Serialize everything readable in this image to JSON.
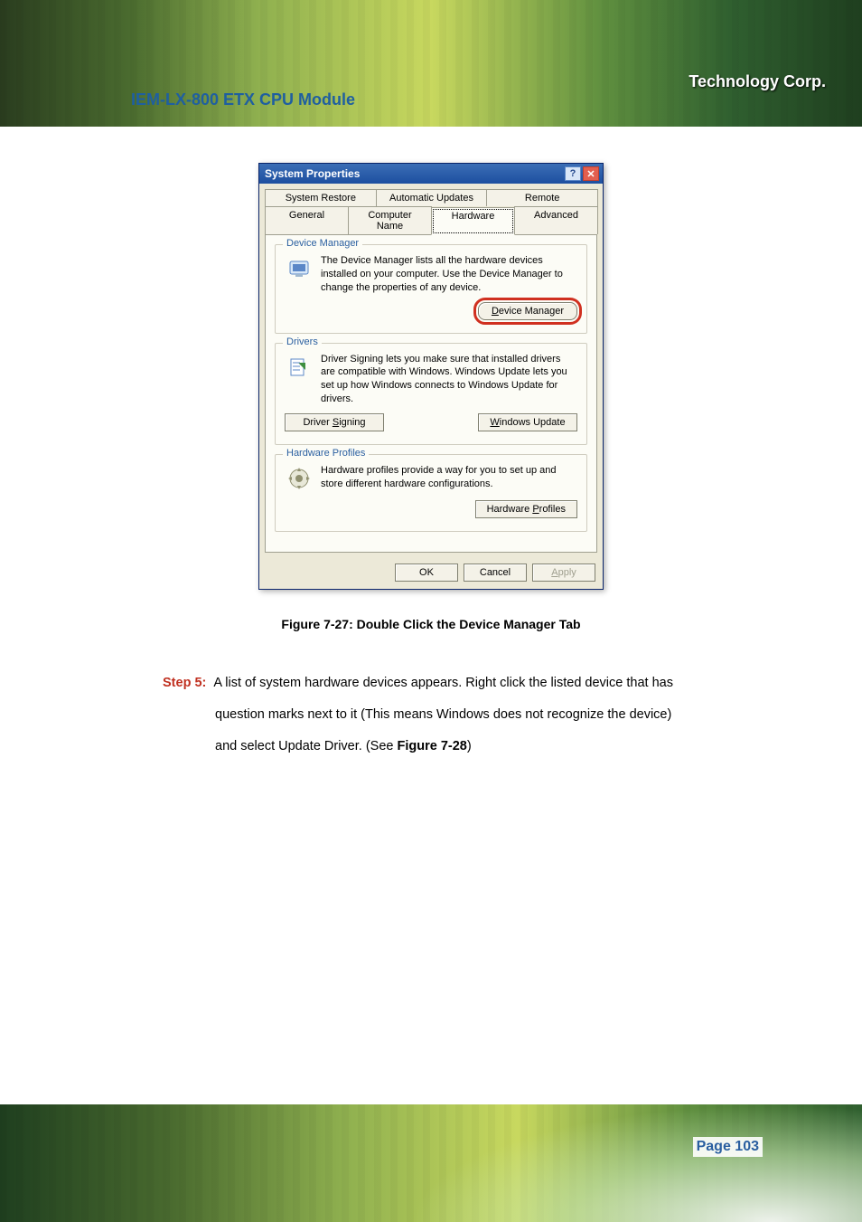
{
  "header": {
    "logo_text": "Technology Corp.",
    "doc_title": "IEM-LX-800 ETX CPU Module"
  },
  "dialog": {
    "title": "System Properties",
    "help_glyph": "?",
    "close_glyph": "✕",
    "tabs_top": [
      "System Restore",
      "Automatic Updates",
      "Remote"
    ],
    "tabs_bottom": [
      "General",
      "Computer Name",
      "Hardware",
      "Advanced"
    ],
    "device_manager": {
      "legend": "Device Manager",
      "text": "The Device Manager lists all the hardware devices installed on your computer. Use the Device Manager to change the properties of any device.",
      "button": "Device Manager"
    },
    "drivers": {
      "legend": "Drivers",
      "text": "Driver Signing lets you make sure that installed drivers are compatible with Windows. Windows Update lets you set up how Windows connects to Windows Update for drivers.",
      "signing_btn": "Driver Signing",
      "update_btn": "Windows Update"
    },
    "profiles": {
      "legend": "Hardware Profiles",
      "text": "Hardware profiles provide a way for you to set up and store different hardware configurations.",
      "button": "Hardware Profiles"
    },
    "footer": {
      "ok": "OK",
      "cancel": "Cancel",
      "apply": "Apply"
    }
  },
  "caption": "Figure 7-27: Double Click the Device Manager Tab",
  "step": {
    "label": "Step 5:",
    "line1": "A list of system hardware devices appears. Right click the listed device that has",
    "line2": "question marks next to it (This means Windows does not recognize the device)",
    "line3_a": "and select Update Driver. (See ",
    "line3_b": "Figure 7-28",
    "line3_c": ")"
  },
  "footer": {
    "page": "Page 103"
  }
}
